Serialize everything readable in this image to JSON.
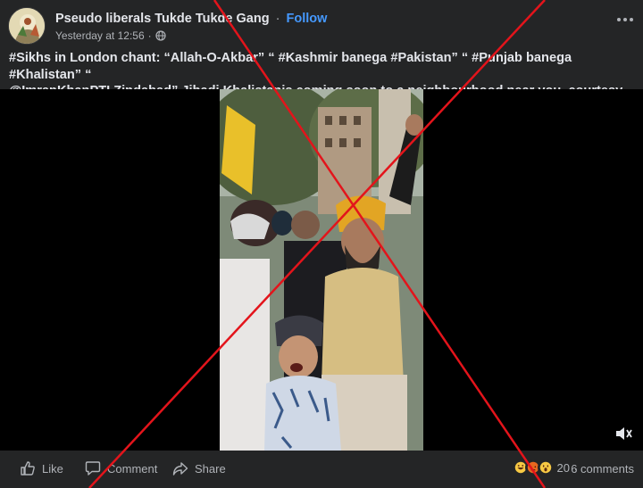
{
  "post": {
    "page_name": "Pseudo liberals Tukde Tukde Gang",
    "separator": "·",
    "follow_label": "Follow",
    "timestamp": "Yesterday at 12:56",
    "meta_separator": "·",
    "caption_line1": "#Sikhs in London chant: “Allah-O-Akbar” “ #Kashmir banega #Pakistan” “ #Punjab banega #Khalistan” “",
    "caption_line2": "@ImranKhanPTI Zindabad” Jihadi Khalistanis coming soon to a neighbourhood near you, courtesy..."
  },
  "footer": {
    "like_label": "Like",
    "comment_label": "Comment",
    "share_label": "Share",
    "reaction_count": "20",
    "dot": "·",
    "comments_label": "6 comments"
  },
  "icons": [
    "avatar",
    "globe-icon",
    "more-options-icon",
    "volume-icon",
    "like-icon",
    "comment-icon",
    "share-icon",
    "haha-reaction-icon",
    "angry-reaction-icon",
    "wow-reaction-icon"
  ],
  "colors": {
    "background": "#242526",
    "text": "#e4e6eb",
    "secondary_text": "#b0b3b8",
    "follow": "#4599ff",
    "cross": "#e3141b"
  }
}
